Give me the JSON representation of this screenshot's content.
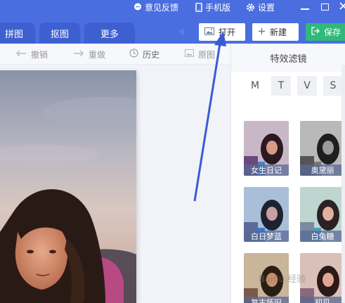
{
  "titlebar": {
    "feedback": "意见反馈",
    "mobile": "手机版",
    "settings": "设置"
  },
  "tabs": [
    "拼图",
    "抠图",
    "更多"
  ],
  "buttons": {
    "open": "打开",
    "new": "新建",
    "save": "保存"
  },
  "toolbar": {
    "undo": "撤销",
    "redo": "重做",
    "history": "历史",
    "original": "原图"
  },
  "panel": {
    "title": "特效滤镜",
    "categories": [
      "M",
      "T",
      "V",
      "S"
    ],
    "filters": [
      "女生日记",
      "奥黛丽",
      "白日梦蓝",
      "白兔糖",
      "复古怀旧",
      "初见"
    ]
  },
  "watermark": "Baidu 经验",
  "colors": {
    "brand": "#4a6ee0",
    "save": "#30b97a",
    "annotation_arrow": "#3a5ad8"
  }
}
